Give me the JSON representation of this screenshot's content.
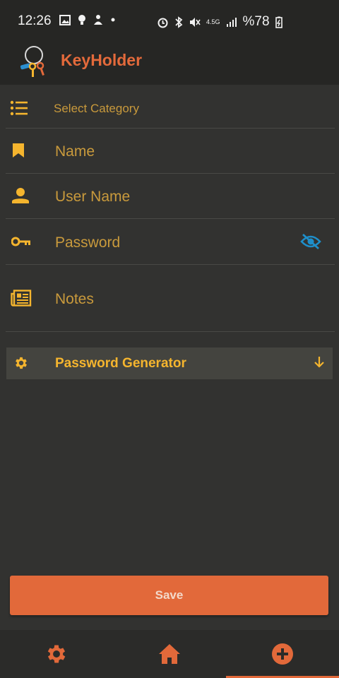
{
  "status_bar": {
    "time": "12:26",
    "network": "4.5G",
    "battery": "%78"
  },
  "app": {
    "title": "KeyHolder"
  },
  "form": {
    "category": {
      "placeholder": "Select Category",
      "icon": "list-icon"
    },
    "name": {
      "placeholder": "Name",
      "icon": "bookmark-icon"
    },
    "username": {
      "placeholder": "User Name",
      "icon": "person-icon"
    },
    "password": {
      "placeholder": "Password",
      "icon": "key-icon",
      "visibility_icon": "eye-off-icon"
    },
    "notes": {
      "placeholder": "Notes",
      "icon": "newspaper-icon"
    }
  },
  "generator": {
    "label": "Password Generator",
    "icon": "gear-icon",
    "expand_icon": "arrow-down-icon"
  },
  "save_label": "Save",
  "bottom_nav": [
    {
      "icon": "gear-icon",
      "active": false
    },
    {
      "icon": "home-icon",
      "active": false
    },
    {
      "icon": "plus-circle-icon",
      "active": true
    }
  ],
  "colors": {
    "accent": "#e2693a",
    "label": "#c99a3c",
    "icon": "#f5b52e",
    "visibility_icon": "#1e8ec9",
    "background": "#323230",
    "bar": "#262624"
  }
}
